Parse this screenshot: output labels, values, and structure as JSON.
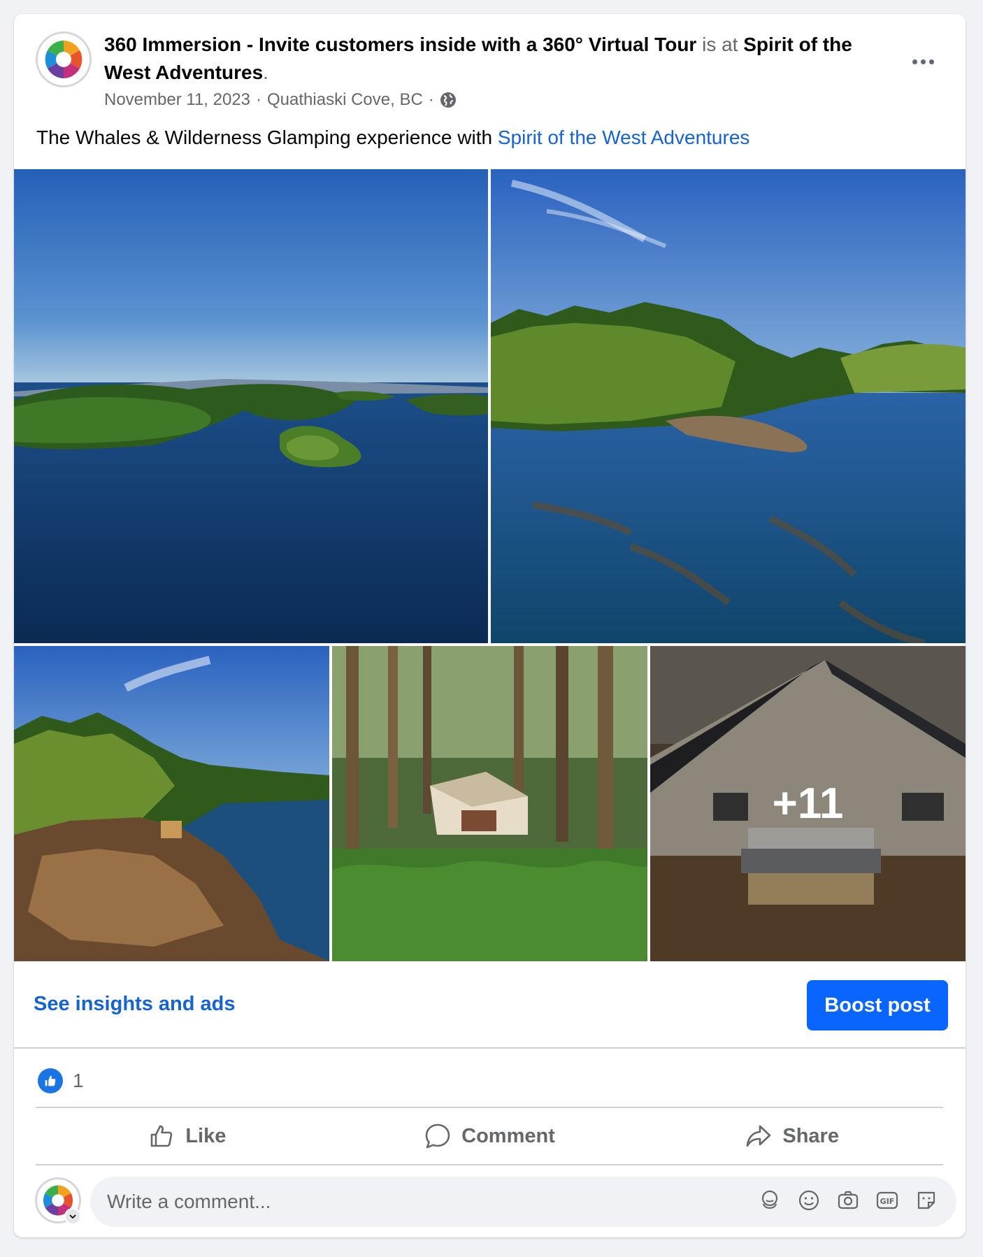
{
  "post": {
    "author": "360 Immersion - Invite customers inside with a 360° Virtual Tour",
    "is_at": "is at",
    "location_page": "Spirit of the West Adventures",
    "period": ".",
    "date": "November 11, 2023",
    "separator": "·",
    "place": "Quathiaski Cove, BC",
    "caption_text": "The Whales & Wilderness Glamping experience with",
    "caption_link": "Spirit of the West Adventures",
    "more_photos_count": "+11"
  },
  "insights": {
    "link_label": "See insights and ads",
    "boost_label": "Boost post"
  },
  "reactions": {
    "count": "1",
    "type": "like"
  },
  "actions": {
    "like": "Like",
    "comment": "Comment",
    "share": "Share"
  },
  "comment_box": {
    "placeholder": "Write a comment..."
  },
  "colors": {
    "link": "#1763cf",
    "boost": "#0866ff",
    "like_badge": "#1b74e4"
  },
  "icons": [
    "more-options-icon",
    "globe-icon",
    "like-badge-icon",
    "thumbs-up-icon",
    "comment-bubble-icon",
    "share-arrow-icon",
    "chevron-down-icon",
    "avatar-sticker-icon",
    "emoji-icon",
    "camera-icon",
    "gif-icon",
    "sticker-icon"
  ]
}
